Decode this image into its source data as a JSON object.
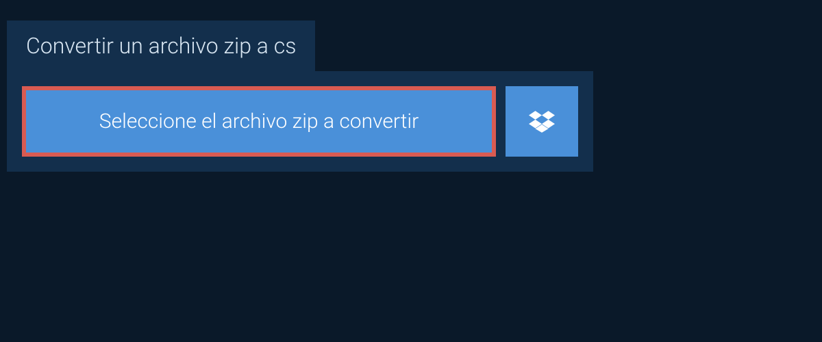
{
  "header": {
    "title": "Convertir un archivo zip a cs"
  },
  "actions": {
    "select_file_label": "Seleccione el archivo zip a convertir",
    "dropbox_icon_name": "dropbox"
  },
  "colors": {
    "background": "#0a1929",
    "panel": "#132f4c",
    "button": "#4a90d9",
    "highlight_border": "#d95b52",
    "text_light": "#ffffff",
    "text_header": "#d8e6f2"
  }
}
